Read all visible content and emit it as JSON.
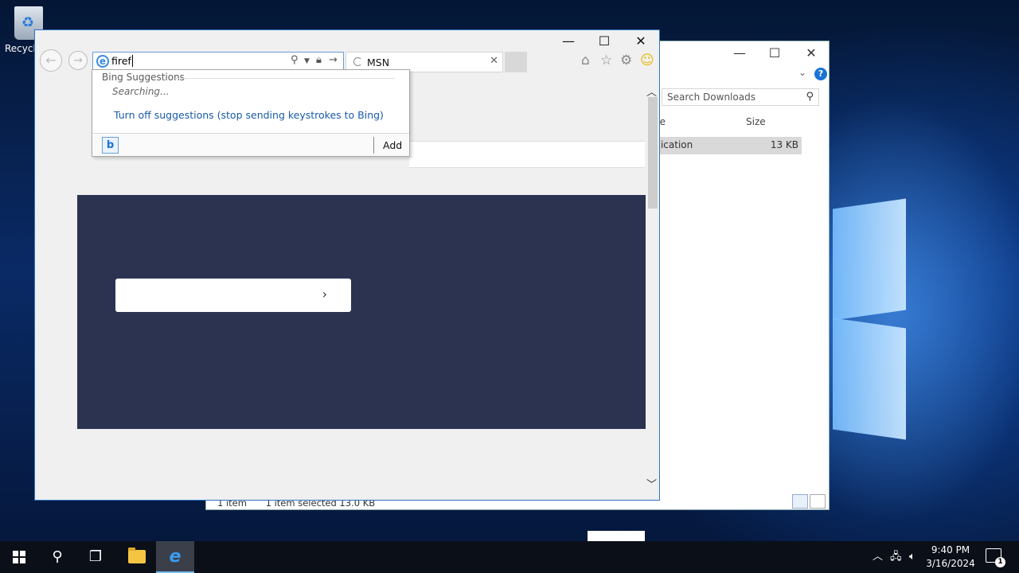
{
  "desktop": {
    "recycle_bin_label": "Recycle"
  },
  "explorer": {
    "search_placeholder": "Search Downloads",
    "columns": [
      "pe",
      "Size"
    ],
    "row": {
      "type": "plication",
      "size": "13 KB"
    },
    "status": {
      "items": "1 item",
      "selected": "1 item selected  13.0 KB"
    }
  },
  "ie": {
    "address_value": "firef",
    "tab_title": "MSN",
    "suggestions": {
      "header": "Bing Suggestions",
      "searching": "Searching...",
      "turn_off": "Turn off suggestions (stop sending keystrokes to Bing)",
      "add": "Add"
    }
  },
  "taskbar": {
    "time": "9:40 PM",
    "date": "3/16/2024",
    "notification_count": "1"
  },
  "colors": {
    "ie_border": "#2a74c4",
    "hero_bg": "#2b3350",
    "link": "#1a5aa8",
    "taskbar": "#0b0f17"
  }
}
